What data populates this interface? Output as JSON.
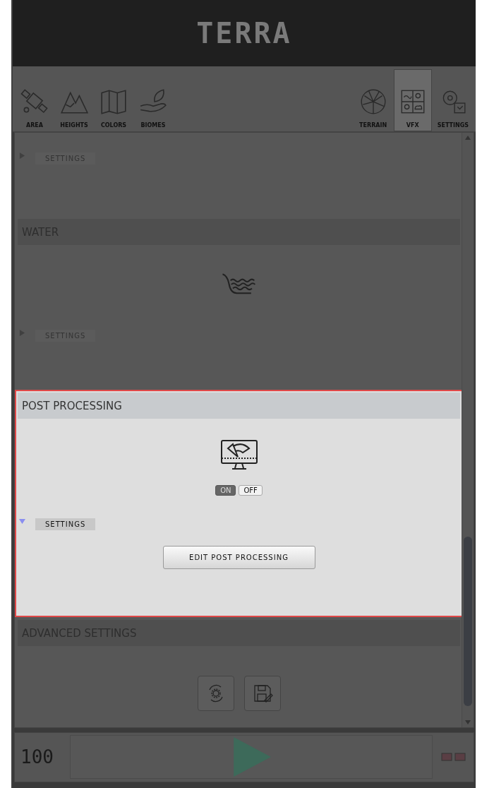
{
  "logo": "TERRA",
  "tools": [
    {
      "label": "AREA",
      "selected": false
    },
    {
      "label": "HEIGHTS",
      "selected": false
    },
    {
      "label": "COLORS",
      "selected": false
    },
    {
      "label": "BIOMES",
      "selected": false
    },
    {
      "label": "TERRAIN",
      "selected": false
    },
    {
      "label": "VFX",
      "selected": true
    },
    {
      "label": "SETTINGS",
      "selected": false
    }
  ],
  "sections": [
    {
      "kind": "partial",
      "highlighted": false,
      "settings": {
        "label": "SETTINGS",
        "expanded": false
      }
    },
    {
      "kind": "water",
      "title": "WATER",
      "highlighted": false,
      "settings": {
        "label": "SETTINGS",
        "expanded": false
      }
    },
    {
      "kind": "post",
      "title": "POST PROCESSING",
      "highlighted": true,
      "toggle": {
        "on_label": "ON",
        "off_label": "OFF",
        "on": true
      },
      "settings": {
        "label": "SETTINGS",
        "expanded": true
      },
      "button": "EDIT POST PROCESSING"
    },
    {
      "kind": "advanced",
      "title": "ADVANCED SETTINGS",
      "highlighted": false
    }
  ],
  "footer": {
    "counter": "100"
  }
}
